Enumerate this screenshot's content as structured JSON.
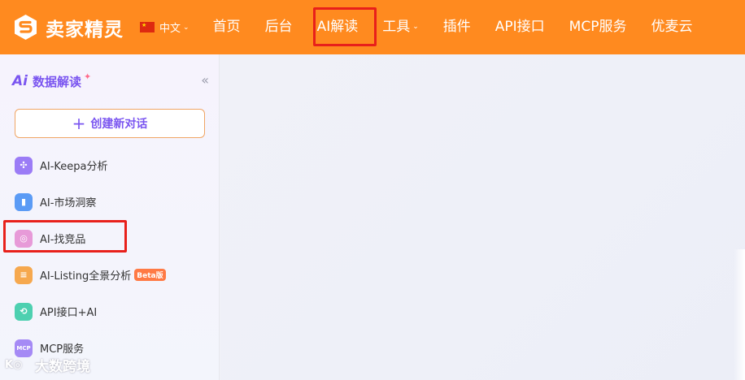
{
  "app": {
    "name": "卖家精灵"
  },
  "header": {
    "language": "中文",
    "nav": [
      {
        "label": "首页"
      },
      {
        "label": "后台"
      },
      {
        "label": "AI解读"
      },
      {
        "label": "工具"
      },
      {
        "label": "插件"
      },
      {
        "label": "API接口"
      },
      {
        "label": "MCP服务"
      },
      {
        "label": "优麦云"
      }
    ]
  },
  "sidebar": {
    "badge": "Ai",
    "title": "数据解读",
    "collapse_icon": "double-chevron-left-icon",
    "new_chat_label": "创建新对话",
    "items": [
      {
        "label": "AI-Keepa分析",
        "icon": "keepa-icon",
        "color": "#9b7cf6"
      },
      {
        "label": "AI-市场洞察",
        "icon": "bar-chart-icon",
        "color": "#5b9bf5"
      },
      {
        "label": "AI-找竞品",
        "icon": "search-product-icon",
        "color": "#e79ad8"
      },
      {
        "label": "AI-Listing全景分析",
        "icon": "listing-icon",
        "color": "#f6a84e",
        "badge": "Beta版"
      },
      {
        "label": "API接口+AI",
        "icon": "api-icon",
        "color": "#4dd0b0"
      },
      {
        "label": "MCP服务",
        "icon": "mcp-icon",
        "color": "#a58af5"
      }
    ]
  },
  "watermark": {
    "text": "大数跨境"
  },
  "colors": {
    "header": "#ff8a1f",
    "accent": "#7a55f0",
    "highlight": "#e8201b"
  }
}
